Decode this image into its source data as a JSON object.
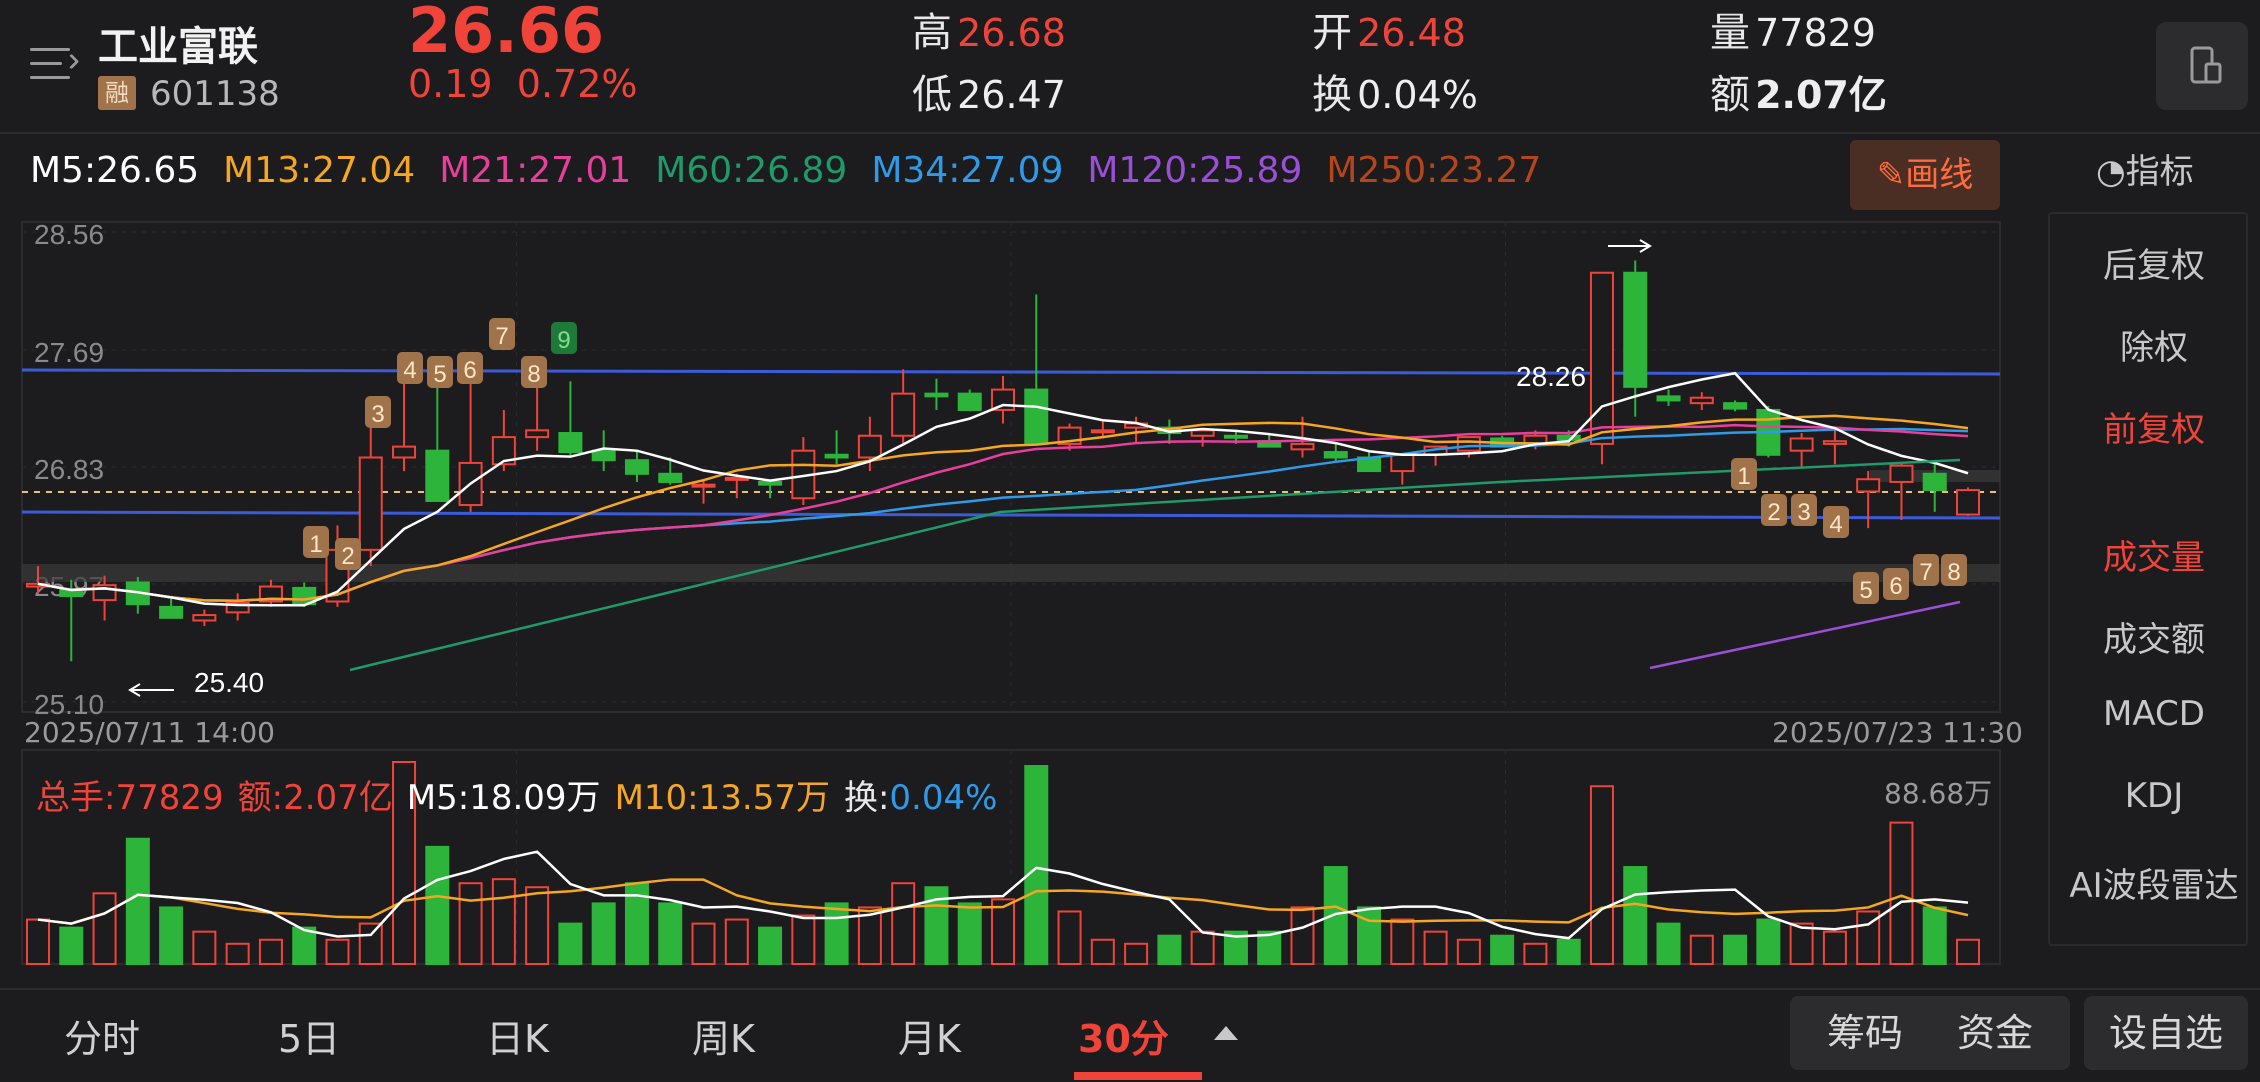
{
  "header": {
    "name": "工业富联",
    "margin_badge": "融",
    "code": "601138",
    "price": "26.66",
    "change": "0.19",
    "change_pct": "0.72%",
    "high_label": "高",
    "high": "26.68",
    "low_label": "低",
    "low": "26.47",
    "open_label": "开",
    "open": "26.48",
    "turnover_label": "换",
    "turnover": "0.04%",
    "volume_label": "量",
    "volume": "77829",
    "amount_label": "额",
    "amount": "2.07亿"
  },
  "ma_legend": [
    {
      "label": "M5:26.65",
      "color": "#ffffff"
    },
    {
      "label": "M13:27.04",
      "color": "#f5a623"
    },
    {
      "label": "M21:27.01",
      "color": "#e83e9c"
    },
    {
      "label": "M60:26.89",
      "color": "#1f9a6a"
    },
    {
      "label": "M34:27.09",
      "color": "#2f9be8"
    },
    {
      "label": "M120:25.89",
      "color": "#9b4fd6"
    },
    {
      "label": "M250:23.27",
      "color": "#b5461c"
    }
  ],
  "draw_button": "画线",
  "indicator_button": "指标",
  "sidebar": [
    "后复权",
    "除权",
    "前复权",
    "成交量",
    "成交额",
    "MACD",
    "KDJ",
    "AI波段雷达"
  ],
  "sidebar_active": [
    "前复权",
    "成交量"
  ],
  "colors": {
    "up": "#f0443a",
    "down": "#2db43a",
    "background": "#1c1c1e"
  },
  "price_axis": [
    "28.56",
    "27.69",
    "26.83",
    "25.97",
    "25.10"
  ],
  "annotations": {
    "high_marker": "28.26",
    "low_marker": "25.40"
  },
  "date_start": "2025/07/11 14:00",
  "date_end": "2025/07/23 11:30",
  "volume_info": {
    "total": "总手:77829",
    "amount": "额:2.07亿",
    "m5": "M5:18.09万",
    "m10": "M10:13.57万",
    "turnover_label": "换:",
    "turnover_value": "0.04%",
    "max": "88.68万"
  },
  "tabs": [
    "分时",
    "5日",
    "日K",
    "周K",
    "月K",
    "30分"
  ],
  "active_tab": "30分",
  "buttons": {
    "chips": "筹码",
    "funds": "资金",
    "custom": "设自选"
  },
  "chart_data": {
    "type": "candlestick",
    "interval": "30分",
    "ylim": [
      25.1,
      28.56
    ],
    "x_start": "2025/07/11 14:00",
    "x_end": "2025/07/23 11:30",
    "ohlc": [
      [
        25.95,
        26.1,
        25.9,
        25.97
      ],
      [
        25.93,
        26.0,
        25.4,
        25.88
      ],
      [
        25.85,
        26.03,
        25.7,
        25.96
      ],
      [
        25.98,
        26.02,
        25.75,
        25.82
      ],
      [
        25.8,
        25.86,
        25.75,
        25.72
      ],
      [
        25.7,
        25.78,
        25.66,
        25.74
      ],
      [
        25.76,
        25.9,
        25.7,
        25.83
      ],
      [
        25.84,
        26.0,
        25.8,
        25.95
      ],
      [
        25.94,
        25.98,
        25.8,
        25.82
      ],
      [
        25.84,
        26.4,
        25.8,
        26.22
      ],
      [
        26.22,
        27.2,
        26.1,
        26.9
      ],
      [
        26.9,
        27.45,
        26.8,
        26.98
      ],
      [
        26.95,
        27.5,
        26.7,
        26.58
      ],
      [
        26.55,
        27.62,
        26.5,
        26.86
      ],
      [
        26.85,
        27.25,
        26.8,
        27.05
      ],
      [
        27.05,
        27.42,
        26.95,
        27.1
      ],
      [
        27.08,
        27.46,
        26.9,
        26.94
      ],
      [
        26.95,
        27.1,
        26.8,
        26.88
      ],
      [
        26.88,
        26.95,
        26.72,
        26.78
      ],
      [
        26.78,
        26.9,
        26.7,
        26.72
      ],
      [
        26.7,
        26.74,
        26.56,
        26.7
      ],
      [
        26.74,
        26.78,
        26.6,
        26.75
      ],
      [
        26.72,
        26.74,
        26.6,
        26.7
      ],
      [
        26.6,
        27.05,
        26.55,
        26.95
      ],
      [
        26.92,
        27.1,
        26.85,
        26.9
      ],
      [
        26.9,
        27.2,
        26.8,
        27.06
      ],
      [
        27.06,
        27.55,
        27.0,
        27.37
      ],
      [
        27.37,
        27.48,
        27.25,
        27.35
      ],
      [
        27.37,
        27.4,
        27.24,
        27.25
      ],
      [
        27.25,
        27.5,
        27.15,
        27.4
      ],
      [
        27.4,
        28.1,
        27.1,
        27.0
      ],
      [
        27.0,
        27.15,
        26.95,
        27.12
      ],
      [
        27.1,
        27.18,
        27.04,
        27.1
      ],
      [
        27.12,
        27.2,
        27.0,
        27.15
      ],
      [
        27.12,
        27.18,
        27.0,
        27.08
      ],
      [
        27.06,
        27.1,
        26.98,
        27.1
      ],
      [
        27.06,
        27.1,
        27.0,
        27.05
      ],
      [
        27.02,
        27.08,
        26.98,
        26.98
      ],
      [
        26.96,
        27.2,
        26.9,
        27.0
      ],
      [
        26.94,
        27.0,
        26.86,
        26.9
      ],
      [
        26.9,
        26.95,
        26.8,
        26.8
      ],
      [
        26.8,
        26.9,
        26.7,
        26.92
      ],
      [
        26.92,
        26.95,
        26.84,
        26.98
      ],
      [
        26.95,
        27.0,
        26.9,
        27.05
      ],
      [
        27.04,
        27.06,
        26.98,
        26.98
      ],
      [
        27.0,
        27.1,
        26.96,
        27.06
      ],
      [
        27.06,
        27.1,
        26.98,
        27.03
      ],
      [
        27.0,
        28.26,
        26.85,
        28.26
      ],
      [
        28.26,
        28.35,
        27.2,
        27.42
      ],
      [
        27.35,
        27.4,
        27.28,
        27.32
      ],
      [
        27.3,
        27.38,
        27.25,
        27.34
      ],
      [
        27.3,
        27.32,
        27.24,
        27.26
      ],
      [
        27.25,
        27.28,
        26.9,
        26.92
      ],
      [
        26.95,
        27.08,
        26.82,
        27.04
      ],
      [
        27.0,
        27.1,
        26.85,
        27.02
      ],
      [
        26.65,
        26.8,
        26.38,
        26.74
      ],
      [
        26.72,
        26.86,
        26.44,
        26.84
      ],
      [
        26.78,
        26.86,
        26.5,
        26.66
      ],
      [
        26.48,
        26.68,
        26.47,
        26.66
      ]
    ],
    "volume_max": "88.68万"
  }
}
